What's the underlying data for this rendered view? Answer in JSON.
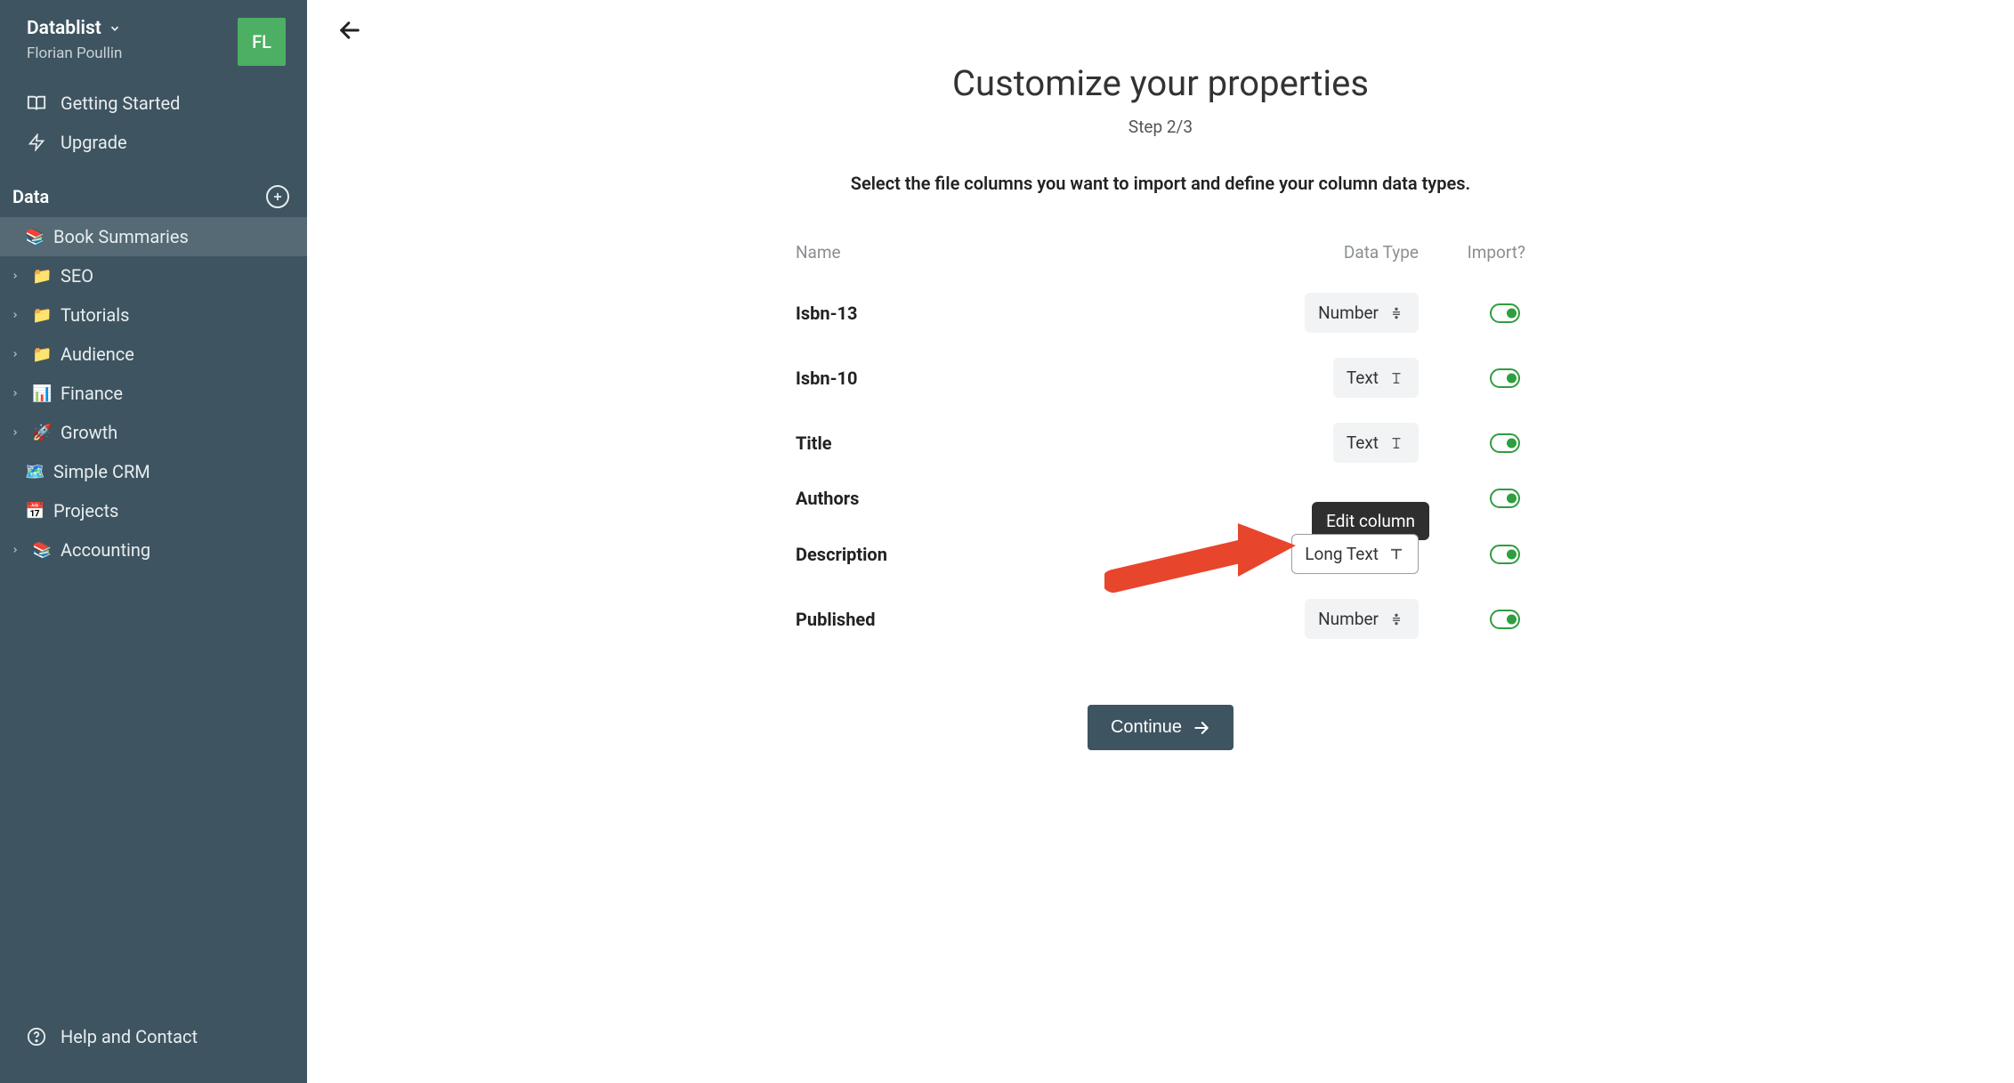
{
  "sidebar": {
    "workspace": "Datablist",
    "username": "Florian Poullin",
    "avatar_initials": "FL",
    "nav": {
      "getting_started": "Getting Started",
      "upgrade": "Upgrade",
      "help": "Help and Contact"
    },
    "section_label": "Data",
    "items": [
      {
        "emoji": "📚",
        "label": "Book Summaries",
        "has_chevron": false,
        "active": true
      },
      {
        "emoji": "📁",
        "label": "SEO",
        "has_chevron": true
      },
      {
        "emoji": "📁",
        "label": "Tutorials",
        "has_chevron": true
      },
      {
        "emoji": "📁",
        "label": "Audience",
        "has_chevron": true
      },
      {
        "emoji": "📊",
        "label": "Finance",
        "has_chevron": true
      },
      {
        "emoji": "🚀",
        "label": "Growth",
        "has_chevron": true
      },
      {
        "emoji": "🗺️",
        "label": "Simple CRM",
        "has_chevron": false
      },
      {
        "emoji": "📅",
        "label": "Projects",
        "has_chevron": false
      },
      {
        "emoji": "📚",
        "label": "Accounting",
        "has_chevron": true
      }
    ]
  },
  "main": {
    "title": "Customize your properties",
    "step_label": "Step 2/3",
    "instruction": "Select the file columns you want to import and define your column data types.",
    "headers": {
      "name": "Name",
      "type": "Data Type",
      "import": "Import?"
    },
    "tooltip": "Edit column",
    "continue_label": "Continue",
    "rows": [
      {
        "name": "Isbn-13",
        "type": "Number",
        "type_kind": "number",
        "highlighted": false,
        "import": true
      },
      {
        "name": "Isbn-10",
        "type": "Text",
        "type_kind": "text",
        "highlighted": false,
        "import": true
      },
      {
        "name": "Title",
        "type": "Text",
        "type_kind": "text",
        "highlighted": false,
        "import": true
      },
      {
        "name": "Authors",
        "type": "",
        "type_kind": "hidden",
        "highlighted": false,
        "import": true
      },
      {
        "name": "Description",
        "type": "Long Text",
        "type_kind": "longtext",
        "highlighted": true,
        "import": true
      },
      {
        "name": "Published",
        "type": "Number",
        "type_kind": "number",
        "highlighted": false,
        "import": true
      }
    ]
  }
}
